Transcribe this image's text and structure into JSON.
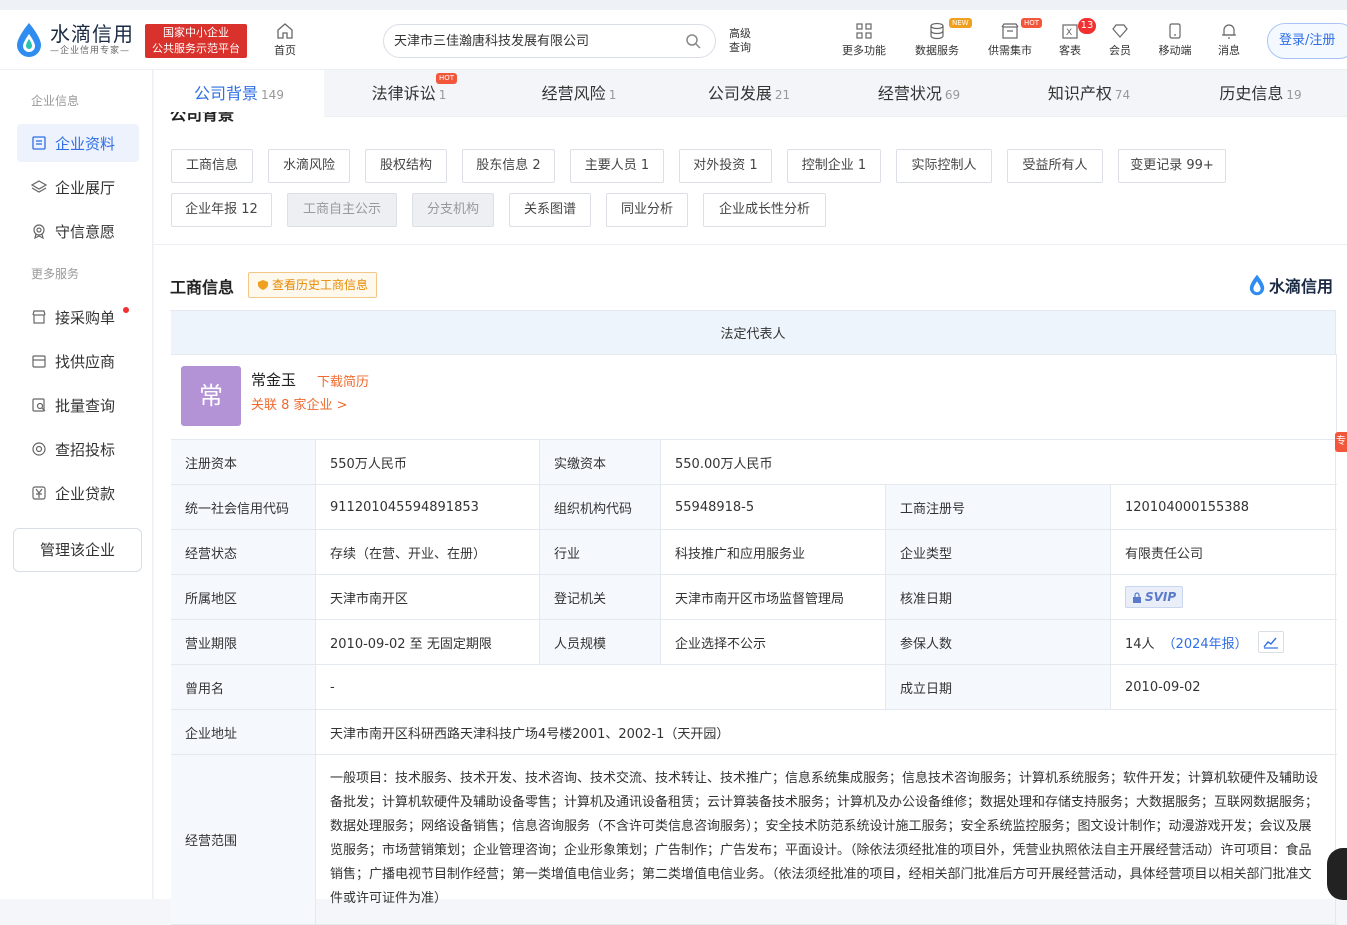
{
  "header": {
    "logo_name": "水滴信用",
    "logo_slogan": "—企业信用专家—",
    "badge_line1": "国家中小企业",
    "badge_line2": "公共服务示范平台",
    "home_label": "首页",
    "search_value": "天津市三佳瀚唐科技发展有限公司",
    "advanced_search": "高级查询",
    "nav": [
      {
        "label": "更多功能",
        "icon": "grid-icon"
      },
      {
        "label": "数据服务",
        "icon": "database-icon",
        "tag": "NEW"
      },
      {
        "label": "供需集市",
        "icon": "market-icon",
        "tag": "HOT"
      },
      {
        "label": "客表",
        "icon": "excel-icon",
        "count": "13"
      },
      {
        "label": "会员",
        "icon": "diamond-icon"
      },
      {
        "label": "移动端",
        "icon": "mobile-icon"
      },
      {
        "label": "消息",
        "icon": "bell-icon"
      }
    ],
    "login_label": "登录/注册"
  },
  "sidebar": {
    "section1": "企业信息",
    "items1": [
      {
        "label": "企业资料"
      },
      {
        "label": "企业展厅"
      },
      {
        "label": "守信意愿"
      }
    ],
    "section2": "更多服务",
    "items2": [
      {
        "label": "接采购单"
      },
      {
        "label": "找供应商"
      },
      {
        "label": "批量查询"
      },
      {
        "label": "查招投标"
      },
      {
        "label": "企业贷款"
      }
    ],
    "manage_label": "管理该企业"
  },
  "tabs": [
    {
      "label": "公司背景",
      "count": "149"
    },
    {
      "label": "法律诉讼",
      "count": "1",
      "tag": "HOT"
    },
    {
      "label": "经营风险",
      "count": "1"
    },
    {
      "label": "公司发展",
      "count": "21"
    },
    {
      "label": "经营状况",
      "count": "69"
    },
    {
      "label": "知识产权",
      "count": "74"
    },
    {
      "label": "历史信息",
      "count": "19"
    }
  ],
  "section_partial": "公司背景",
  "chips": [
    "工商信息",
    "水滴风险",
    "股权结构",
    "股东信息 2",
    "主要人员 1",
    "对外投资 1",
    "控制企业 1",
    "实际控制人",
    "受益所有人",
    "变更记录 99+",
    "企业年报 12",
    "工商自主公示",
    "分支机构",
    "关系图谱",
    "同业分析",
    "企业成长性分析"
  ],
  "business": {
    "title": "工商信息",
    "history_btn": "查看历史工商信息",
    "watermark": "水滴信用",
    "legal_head": "法定代表人",
    "rep_avatar": "常",
    "rep_name": "常金玉",
    "rep_download": "下载简历",
    "rep_related": "关联 8 家企业 >",
    "labels": {
      "reg_capital": "注册资本",
      "paid_capital": "实缴资本",
      "credit_code": "统一社会信用代码",
      "org_code": "组织机构代码",
      "reg_no": "工商注册号",
      "status": "经营状态",
      "industry": "行业",
      "company_type": "企业类型",
      "region": "所属地区",
      "authority": "登记机关",
      "approve_date": "核准日期",
      "term": "营业期限",
      "staff_size": "人员规模",
      "insured": "参保人数",
      "former_name": "曾用名",
      "found_date": "成立日期",
      "address": "企业地址",
      "scope": "经营范围"
    },
    "values": {
      "reg_capital": "550万人民币",
      "paid_capital": "550.00万人民币",
      "credit_code": "911201045594891853",
      "org_code": "55948918-5",
      "reg_no": "120104000155388",
      "status": "存续（在营、开业、在册）",
      "industry": "科技推广和应用服务业",
      "company_type": "有限责任公司",
      "region": "天津市南开区",
      "authority": "天津市南开区市场监督管理局",
      "approve_date": "SVIP",
      "term": "2010-09-02 至 无固定期限",
      "staff_size": "企业选择不公示",
      "insured": "14人",
      "insured_year": "（2024年报）",
      "former_name": "-",
      "found_date": "2010-09-02",
      "address": "天津市南开区科研西路天津科技广场4号楼2001、2002-1（天开园）",
      "scope": "一般项目：技术服务、技术开发、技术咨询、技术交流、技术转让、技术推广；信息系统集成服务；信息技术咨询服务；计算机系统服务；软件开发；计算机软硬件及辅助设备批发；计算机软硬件及辅助设备零售；计算机及通讯设备租赁；云计算装备技术服务；计算机及办公设备维修；数据处理和存储支持服务；大数据服务；互联网数据服务；数据处理服务；网络设备销售；信息咨询服务（不含许可类信息咨询服务）；安全技术防范系统设计施工服务；安全系统监控服务；图文设计制作；动漫游戏开发；会议及展览服务；市场营销策划；企业管理咨询；企业形象策划；广告制作；广告发布；平面设计。（除依法须经批准的项目外，凭营业执照依法自主开展经营活动）许可项目：食品销售；广播电视节目制作经营；第一类增值电信业务；第二类增值电信业务。（依法须经批准的项目，经相关部门批准后方可开展经营活动，具体经营项目以相关部门批准文件或许可证件为准）"
    }
  },
  "side_tab": "专"
}
